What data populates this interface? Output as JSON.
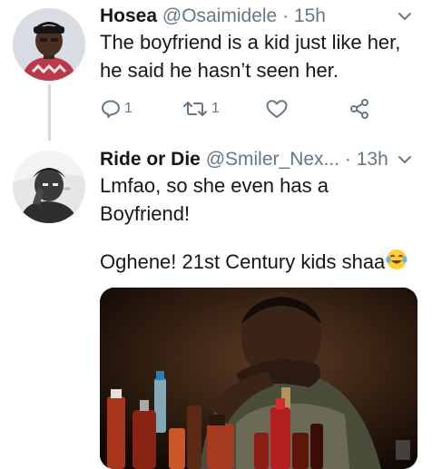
{
  "tweets": [
    {
      "name": "Hosea",
      "handle": "@Osaimidele",
      "separator": "·",
      "time": "15h",
      "lines": [
        "The boyfriend is a kid just like her,",
        "he said he hasn’t seen her."
      ],
      "reply_count": "1",
      "retweet_count": "1",
      "like_count": "",
      "icons": [
        "reply-icon",
        "retweet-icon",
        "like-icon",
        "share-icon",
        "chevron-down-icon"
      ]
    },
    {
      "name": "Ride or Die",
      "handle": "@Smiler_Nex...",
      "separator": "·",
      "time": "13h",
      "lines": [
        "Lmfao, so she even has a",
        "Boyfriend!"
      ],
      "line3": "Oghene!  21st Century kids shaa",
      "emoji": "face-with-tears-of-joy-icon"
    }
  ],
  "colors": {
    "text": "#14171a",
    "secondary": "#657786",
    "thread": "#cfd9de"
  }
}
